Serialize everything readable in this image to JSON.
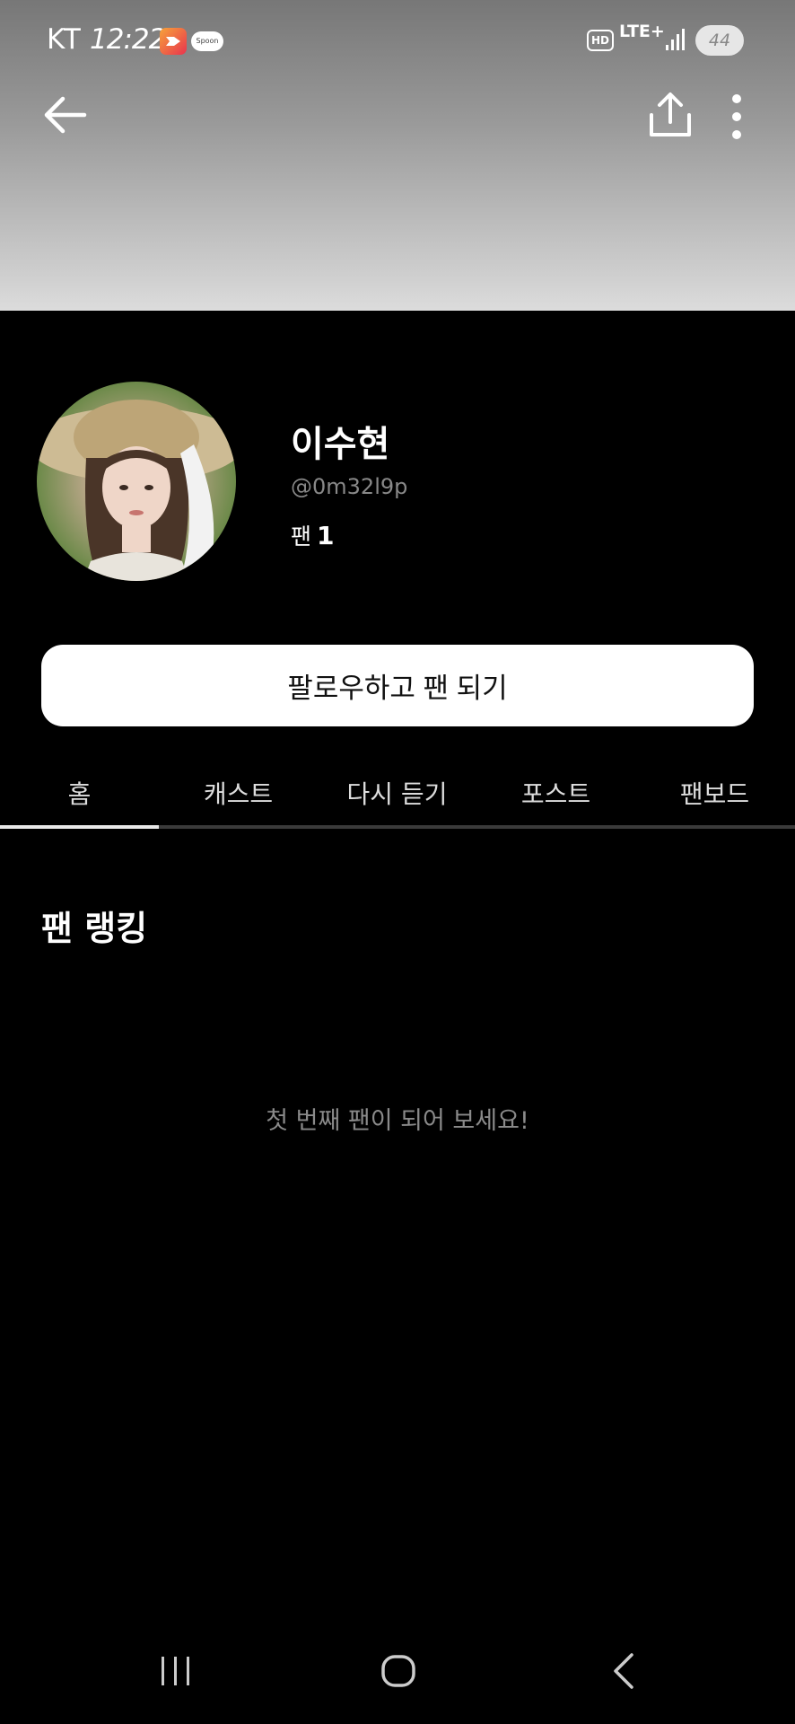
{
  "status_bar": {
    "carrier": "KT",
    "time": "12:22",
    "spoon_label": "Spoon",
    "hd_label": "HD",
    "network": "LTE+",
    "battery": "44"
  },
  "profile": {
    "name": "이수현",
    "handle": "@0m32l9p",
    "fan_label": "팬",
    "fan_count": "1"
  },
  "follow_button_label": "팔로우하고 팬 되기",
  "tabs": [
    {
      "label": "홈",
      "active": true
    },
    {
      "label": "캐스트",
      "active": false
    },
    {
      "label": "다시 듣기",
      "active": false
    },
    {
      "label": "포스트",
      "active": false
    },
    {
      "label": "팬보드",
      "active": false
    }
  ],
  "fan_ranking": {
    "title": "팬 랭킹",
    "empty_message": "첫 번째 팬이 되어 보세요!"
  },
  "colors": {
    "background": "#000000",
    "button": "#ffffff",
    "muted_text": "#8a8a8a"
  }
}
